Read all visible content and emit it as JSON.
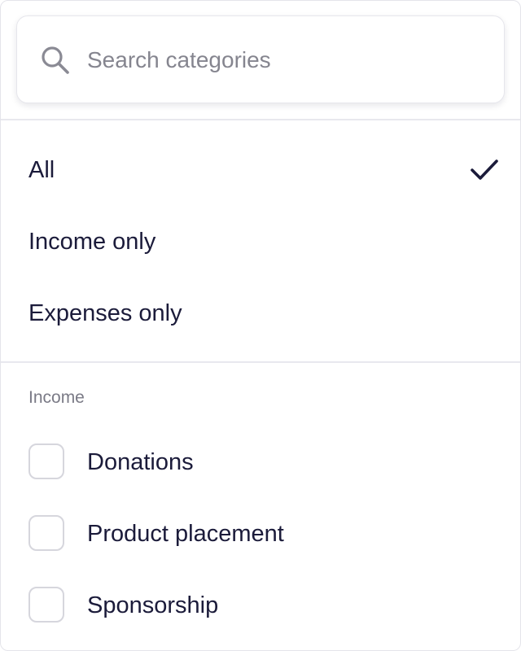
{
  "search": {
    "placeholder": "Search categories",
    "value": ""
  },
  "filter_options": [
    {
      "label": "All",
      "selected": true
    },
    {
      "label": "Income only",
      "selected": false
    },
    {
      "label": "Expenses only",
      "selected": false
    }
  ],
  "income_section": {
    "title": "Income",
    "items": [
      {
        "label": "Donations",
        "checked": false
      },
      {
        "label": "Product placement",
        "checked": false
      },
      {
        "label": "Sponsorship",
        "checked": false
      }
    ]
  },
  "icons": {
    "search": "search-icon",
    "selected_marker": "check-icon"
  },
  "colors": {
    "text": "#1b1b3a",
    "placeholder": "#85858f",
    "muted": "#7a7a86",
    "border": "#e4e4ea"
  }
}
